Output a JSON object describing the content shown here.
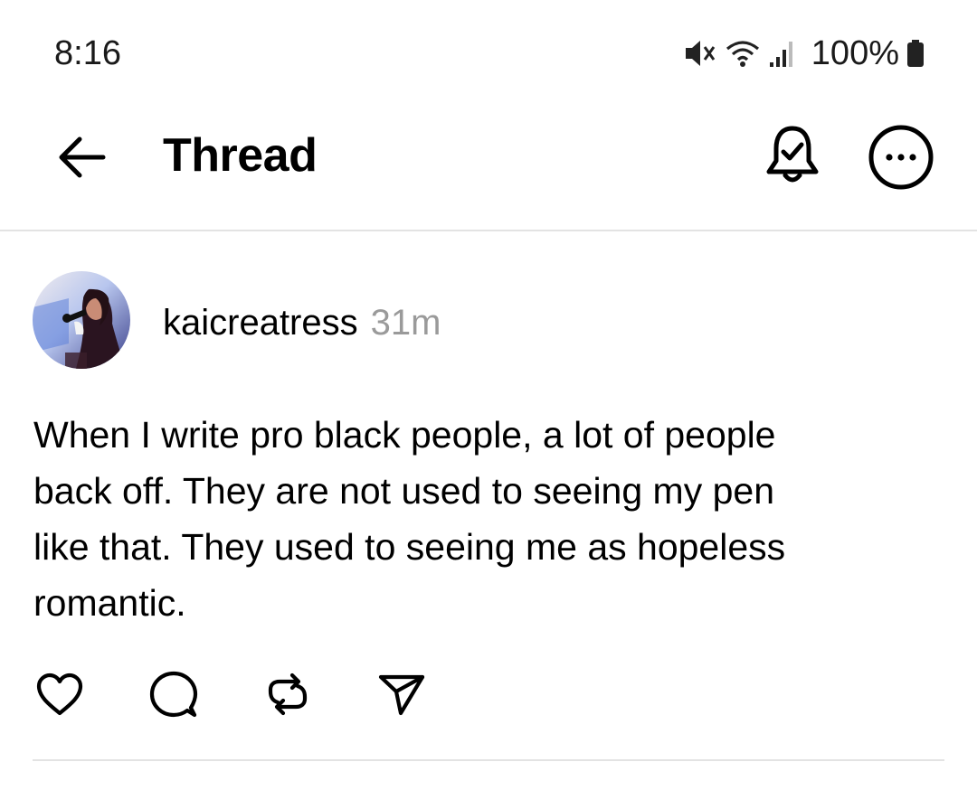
{
  "status_bar": {
    "time": "8:16",
    "battery": "100%",
    "icons": [
      "mute-icon",
      "wifi-icon",
      "signal-icon",
      "battery-icon"
    ]
  },
  "header": {
    "title": "Thread",
    "icons": [
      "back-arrow-icon",
      "bell-check-icon",
      "more-options-icon"
    ]
  },
  "post": {
    "username": "kaicreatress",
    "timestamp": "31m",
    "text": "When I write pro black people,  a lot of people\nback off. They are not used to seeing my pen\nlike that.  They used to seeing me as hopeless\nromantic.",
    "actions": [
      "heart-icon",
      "comment-icon",
      "repost-icon",
      "send-icon"
    ]
  },
  "colors": {
    "text": "#000000",
    "muted": "#9a9a9a",
    "divider": "#e3e3e3",
    "background": "#ffffff"
  }
}
